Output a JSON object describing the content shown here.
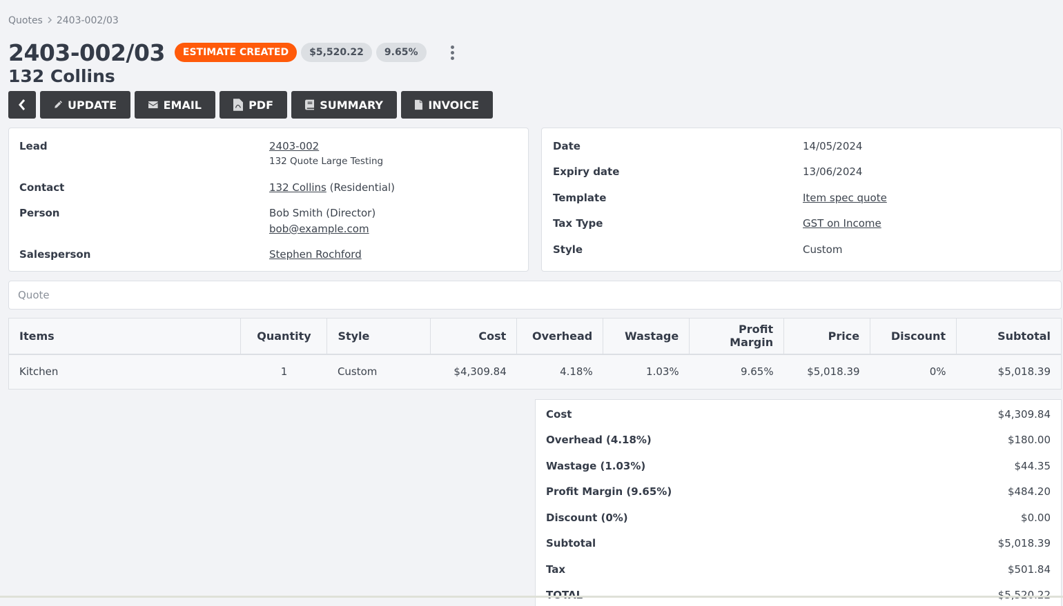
{
  "breadcrumb": {
    "parent": "Quotes",
    "current": "2403-002/03"
  },
  "header": {
    "title": "2403-002/03",
    "status": "ESTIMATE CREATED",
    "total_badge": "$5,520.22",
    "margin_badge": "9.65%",
    "subtitle": "132 Collins"
  },
  "toolbar": {
    "update": "UPDATE",
    "email": "EMAIL",
    "pdf": "PDF",
    "summary": "SUMMARY",
    "invoice": "INVOICE"
  },
  "left_card": {
    "lead_label": "Lead",
    "lead_value": "2403-002",
    "lead_desc": "132 Quote Large Testing",
    "contact_label": "Contact",
    "contact_value": "132 Collins",
    "contact_type": "(Residential)",
    "person_label": "Person",
    "person_value": "Bob Smith (Director)",
    "person_email": "bob@example.com",
    "salesperson_label": "Salesperson",
    "salesperson_value": "Stephen Rochford"
  },
  "right_card": {
    "date_label": "Date",
    "date_value": "14/05/2024",
    "expiry_label": "Expiry date",
    "expiry_value": "13/06/2024",
    "template_label": "Template",
    "template_value": "Item spec quote",
    "tax_label": "Tax Type",
    "tax_value": "GST on Income",
    "style_label": "Style",
    "style_value": "Custom"
  },
  "quote_placeholder": "Quote",
  "items": {
    "headers": [
      "Items",
      "Quantity",
      "Style",
      "Cost",
      "Overhead",
      "Wastage",
      "Profit Margin",
      "Price",
      "Discount",
      "Subtotal"
    ],
    "rows": [
      [
        "Kitchen",
        "1",
        "Custom",
        "$4,309.84",
        "4.18%",
        "1.03%",
        "9.65%",
        "$5,018.39",
        "0%",
        "$5,018.39"
      ]
    ]
  },
  "totals": [
    {
      "label": "Cost",
      "value": "$4,309.84"
    },
    {
      "label": "Overhead (4.18%)",
      "value": "$180.00"
    },
    {
      "label": "Wastage (1.03%)",
      "value": "$44.35"
    },
    {
      "label": "Profit Margin (9.65%)",
      "value": "$484.20"
    },
    {
      "label": "Discount (0%)",
      "value": "$0.00"
    },
    {
      "label": "Subtotal",
      "value": "$5,018.39"
    },
    {
      "label": "Tax",
      "value": "$501.84"
    },
    {
      "label": "TOTAL",
      "value": "$5,520.22"
    }
  ],
  "colors": {
    "status": "#ff5a0a",
    "button": "#3b3d41",
    "background": "#f2f3f6"
  }
}
